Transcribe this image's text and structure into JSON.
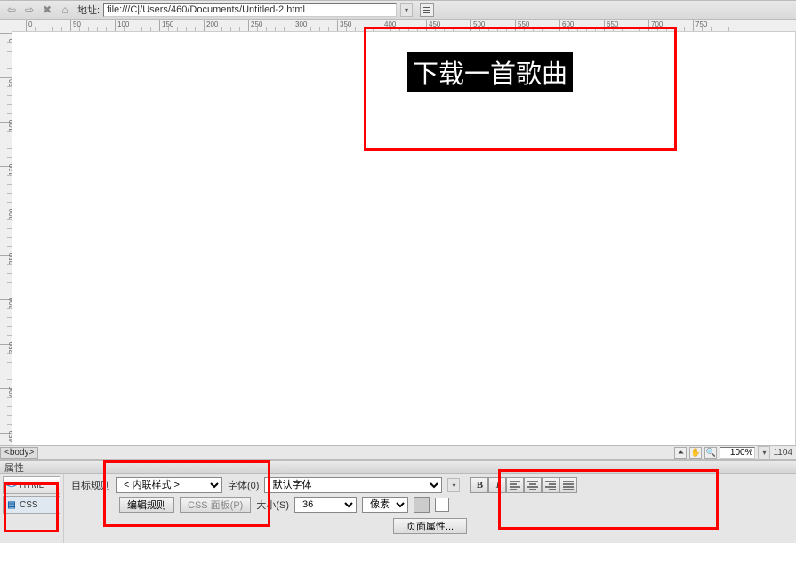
{
  "addressbar": {
    "label": "地址:",
    "value": "file:///C|/Users/460/Documents/Untitled-2.html"
  },
  "ruler": {
    "h_ticks": [
      0,
      50,
      100,
      150,
      200,
      250,
      300,
      350,
      400,
      450,
      500,
      550,
      600,
      650,
      700,
      750
    ],
    "v_ticks": [
      0,
      50,
      100,
      150,
      200,
      250,
      300,
      350,
      400,
      450
    ]
  },
  "canvas": {
    "selected_text": "下载一首歌曲"
  },
  "tagbar": {
    "tag": "<body>",
    "zoom": "100%",
    "dim": "1104"
  },
  "properties": {
    "title": "属性",
    "tabs": {
      "html": "HTML",
      "css": "CSS"
    },
    "target_rule_label": "目标规则",
    "target_rule_value": "< 内联样式 >",
    "edit_rule_btn": "编辑规则",
    "css_panel_btn": "CSS 面板(P)",
    "font_label": "字体(0)",
    "font_value": "默认字体",
    "size_label": "大小(S)",
    "size_value": "36",
    "unit_value": "像素( ",
    "page_props_btn": "页面属性..."
  }
}
